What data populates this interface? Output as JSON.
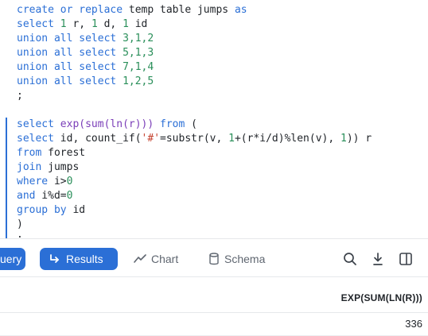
{
  "editor": {
    "block1": [
      [
        {
          "t": "create or replace ",
          "c": "kw"
        },
        {
          "t": "temp table jumps ",
          "c": ""
        },
        {
          "t": "as",
          "c": "kw"
        }
      ],
      [
        {
          "t": "select ",
          "c": "kw"
        },
        {
          "t": "1",
          "c": "num"
        },
        {
          "t": " r, ",
          "c": ""
        },
        {
          "t": "1",
          "c": "num"
        },
        {
          "t": " d, ",
          "c": ""
        },
        {
          "t": "1",
          "c": "num"
        },
        {
          "t": " id",
          "c": ""
        }
      ],
      [
        {
          "t": "union all select ",
          "c": "kw"
        },
        {
          "t": "3,1,2",
          "c": "num"
        }
      ],
      [
        {
          "t": "union all select ",
          "c": "kw"
        },
        {
          "t": "5,1,3",
          "c": "num"
        }
      ],
      [
        {
          "t": "union all select ",
          "c": "kw"
        },
        {
          "t": "7,1,4",
          "c": "num"
        }
      ],
      [
        {
          "t": "union all select ",
          "c": "kw"
        },
        {
          "t": "1,2,5",
          "c": "num"
        }
      ],
      [
        {
          "t": ";",
          "c": ""
        }
      ]
    ],
    "block2": [
      [
        {
          "t": "select ",
          "c": "kw"
        },
        {
          "t": "exp(sum(ln(r))) ",
          "c": "fn"
        },
        {
          "t": "from",
          "c": "kw"
        },
        {
          "t": " (",
          "c": ""
        }
      ],
      [
        {
          "t": "select ",
          "c": "kw"
        },
        {
          "t": "id, count_if(",
          "c": ""
        },
        {
          "t": "'#'",
          "c": "str"
        },
        {
          "t": "=substr(v, ",
          "c": ""
        },
        {
          "t": "1",
          "c": "num"
        },
        {
          "t": "+(r*i/d)%len(v), ",
          "c": ""
        },
        {
          "t": "1",
          "c": "num"
        },
        {
          "t": ")) r",
          "c": ""
        }
      ],
      [
        {
          "t": "from",
          "c": "kw"
        },
        {
          "t": " forest",
          "c": ""
        }
      ],
      [
        {
          "t": "join",
          "c": "kw"
        },
        {
          "t": " jumps",
          "c": ""
        }
      ],
      [
        {
          "t": "where",
          "c": "kw"
        },
        {
          "t": " i>",
          "c": ""
        },
        {
          "t": "0",
          "c": "num"
        }
      ],
      [
        {
          "t": "and",
          "c": "kw"
        },
        {
          "t": " i%d=",
          "c": ""
        },
        {
          "t": "0",
          "c": "num"
        }
      ],
      [
        {
          "t": "group by",
          "c": "kw"
        },
        {
          "t": " id",
          "c": ""
        }
      ],
      [
        {
          "t": ")",
          "c": ""
        }
      ],
      [
        {
          "t": ";",
          "c": ""
        }
      ]
    ]
  },
  "toolbar": {
    "query_label": "uery",
    "results_label": "Results",
    "chart_label": "Chart",
    "schema_label": "Schema"
  },
  "results": {
    "column": "EXP(SUM(LN(R)))",
    "rows": [
      "336"
    ]
  },
  "colors": {
    "accent": "#2b6fd6",
    "keyword": "#2b6fd6",
    "number": "#2a8f5a",
    "string": "#c5422f"
  }
}
